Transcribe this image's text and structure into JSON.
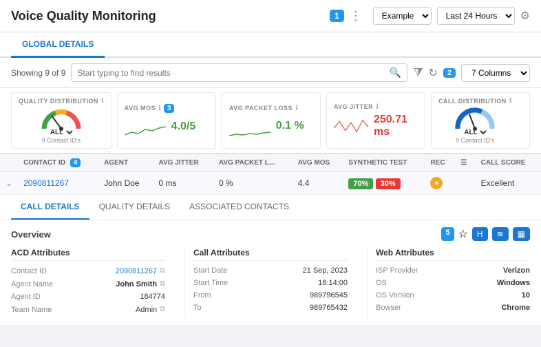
{
  "header": {
    "title": "Voice Quality Monitoring",
    "badge1": "1",
    "dots": "⋮",
    "dropdown1": "Example",
    "dropdown2": "Last 24 Hours",
    "filter_icon": "⚙"
  },
  "tabs": {
    "items": [
      {
        "label": "GLOBAL DETAILS",
        "active": true
      }
    ]
  },
  "toolbar": {
    "showing": "Showing 9 of 9",
    "search_placeholder": "Start typing to find results",
    "badge2": "2",
    "columns_label": "7 Columns"
  },
  "stats": [
    {
      "label": "QUALITY DISTRIBUTION",
      "type": "gauge",
      "select": "ALL",
      "sub": "9 Contact ID's"
    },
    {
      "label": "AVG MOS",
      "type": "value",
      "value": "4.0/5",
      "color": "green",
      "badge3": "3"
    },
    {
      "label": "AVG PACKET LOSS",
      "type": "value",
      "value": "0.1 %",
      "color": "green"
    },
    {
      "label": "AVG JITTER",
      "type": "value",
      "value": "250.71 ms",
      "color": "red"
    },
    {
      "label": "CALL DISTRIBUTION",
      "type": "gauge2",
      "select": "ALL",
      "sub": "9 Contact ID's"
    }
  ],
  "table": {
    "columns": [
      "CONTACT ID",
      "AGENT",
      "AVG JITTER",
      "AVG PACKET L...",
      "AVG MOS",
      "SYNTHETIC TEST",
      "REC",
      "CALL SCORE"
    ],
    "rows": [
      {
        "contact_id": "2090811267",
        "agent": "John Doe",
        "avg_jitter": "0 ms",
        "avg_packet_loss": "0 %",
        "avg_mos": "4.4",
        "synthetic_green": "70%",
        "synthetic_red": "30%",
        "rec": "●",
        "call_score": "Excellent",
        "badge4": "4"
      }
    ]
  },
  "detail_tabs": [
    {
      "label": "CALL DETAILS",
      "active": true
    },
    {
      "label": "QUALITY DETAILS",
      "active": false
    },
    {
      "label": "ASSOCIATED CONTACTS",
      "active": false
    }
  ],
  "detail": {
    "overview_title": "Overview",
    "badge5": "5",
    "acd": {
      "title": "ACD Attributes",
      "rows": [
        {
          "key": "Contact ID",
          "val": "2090811267",
          "type": "link"
        },
        {
          "key": "Agent Name",
          "val": "John Smith",
          "type": "copy"
        },
        {
          "key": "Agent ID",
          "val": "184774",
          "type": "normal"
        },
        {
          "key": "Team Name",
          "val": "Admin",
          "type": "copy"
        }
      ]
    },
    "call": {
      "title": "Call Attributes",
      "rows": [
        {
          "key": "Start Date",
          "val": "21 Sep, 2023"
        },
        {
          "key": "Start Time",
          "val": "18:14:00"
        },
        {
          "key": "From",
          "val": "989796545"
        },
        {
          "key": "To",
          "val": "989765432"
        }
      ]
    },
    "web": {
      "title": "Web  Attributes",
      "rows": [
        {
          "key": "ISP Provider",
          "val": "Verizon",
          "bold": true
        },
        {
          "key": "OS",
          "val": "Windows",
          "bold": true
        },
        {
          "key": "OS Version",
          "val": "10",
          "bold": true
        },
        {
          "key": "Bowser",
          "val": "Chrome",
          "bold": true
        }
      ]
    },
    "panel_icons": [
      {
        "icon": "☆",
        "name": "star-icon"
      },
      {
        "icon": "H",
        "name": "h-icon",
        "blue": true
      },
      {
        "icon": "≋",
        "name": "grid-icon",
        "blue": true
      },
      {
        "icon": "▦",
        "name": "chart-icon",
        "blue": true
      }
    ]
  }
}
